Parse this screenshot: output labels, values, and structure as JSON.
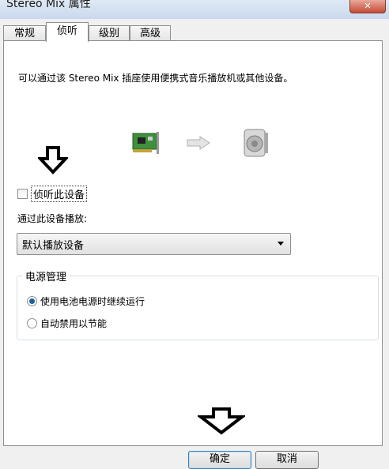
{
  "window": {
    "title": "Stereo Mix 属性",
    "close_glyph": "✕"
  },
  "tabs": [
    {
      "label": "常规",
      "active": false
    },
    {
      "label": "侦听",
      "active": true
    },
    {
      "label": "级别",
      "active": false
    },
    {
      "label": "高级",
      "active": false
    }
  ],
  "listen": {
    "description": "可以通过该 Stereo Mix 插座使用便携式音乐播放机或其他设备。",
    "icons": [
      "sound-card-icon",
      "arrow-right-icon",
      "speaker-icon"
    ],
    "listen_checkbox": {
      "label": "侦听此设备",
      "checked": false
    },
    "playback_label": "通过此设备播放:",
    "playback_select": {
      "value": "默认播放设备"
    },
    "power": {
      "title": "电源管理",
      "options": [
        {
          "label": "使用电池电源时继续运行",
          "selected": true
        },
        {
          "label": "自动禁用以节能",
          "selected": false
        }
      ]
    }
  },
  "annotations": [
    "down-arrow-icon",
    "down-arrow-icon"
  ],
  "buttons": {
    "ok": "确定",
    "cancel": "取消"
  },
  "colors": {
    "accent": "#1b5f9f",
    "title_bar": "#c9d9ec"
  }
}
